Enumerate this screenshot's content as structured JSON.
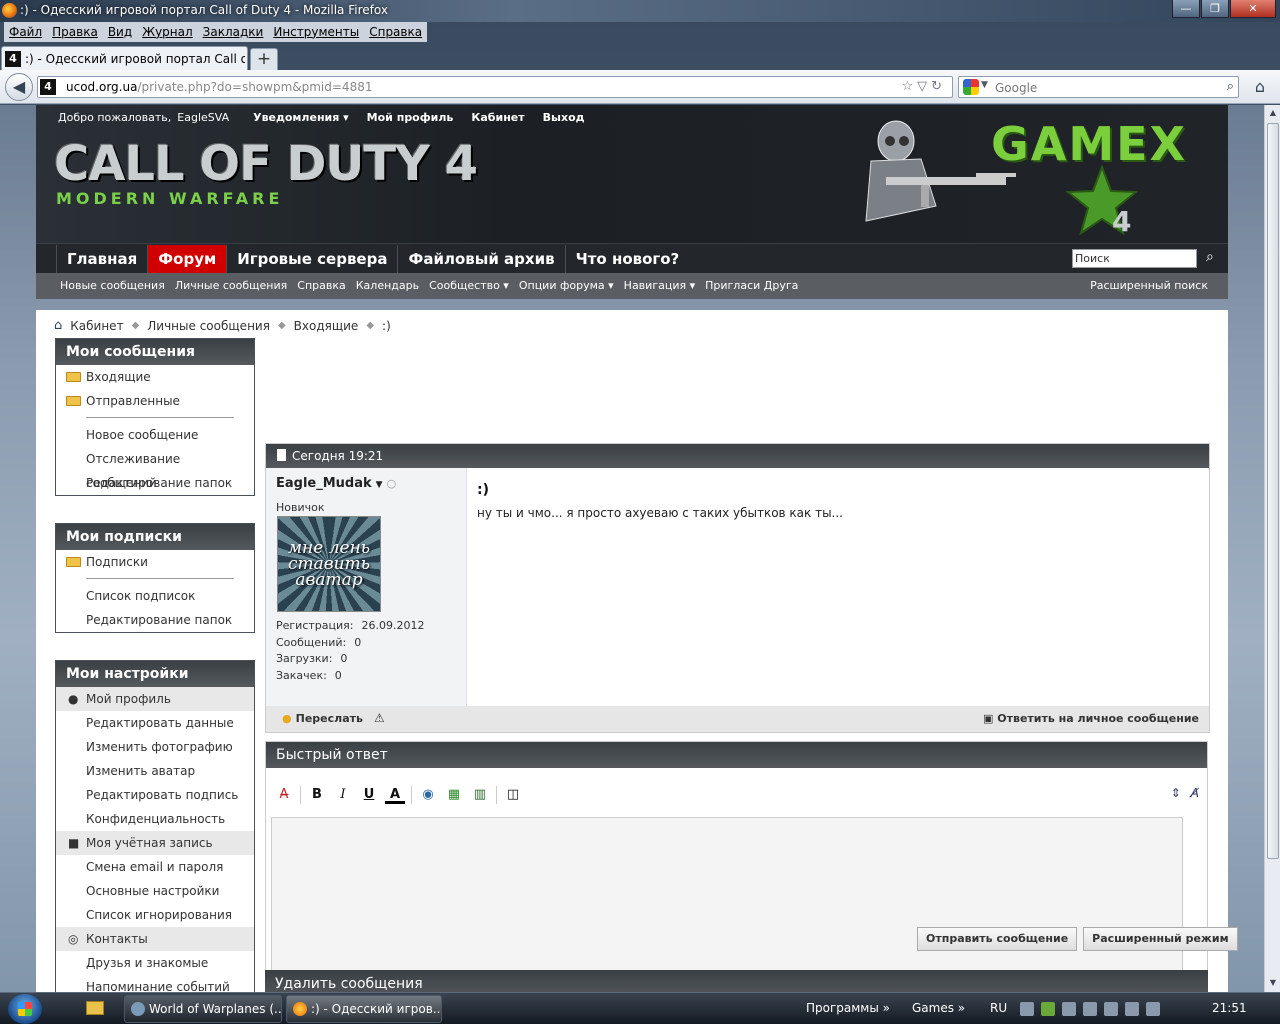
{
  "window": {
    "title": ":) - Одесский игровой портал Call of Duty 4 - Mozilla Firefox",
    "menu": [
      "Файл",
      "Правка",
      "Вид",
      "Журнал",
      "Закладки",
      "Инструменты",
      "Справка"
    ],
    "tab_label": ":) - Одесский игровой портал Call of D...",
    "favicon_text": "4",
    "new_tab": "+",
    "url_host": "ucod.org.ua",
    "url_path": "/private.php?do=showpm&pmid=4881",
    "search_engine": "Google"
  },
  "header": {
    "welcome": "Добро пожаловать,",
    "username": "EagleSVA",
    "links": [
      "Уведомления ▾",
      "Мой профиль",
      "Кабинет",
      "Выход"
    ],
    "logo_cod": "CALL OF DUTY 4",
    "logo_mw": "MODERN WARFARE",
    "logo_gamex": "GAMEX",
    "logo_4": "4"
  },
  "nav": {
    "items": [
      "Главная",
      "Форум",
      "Игровые сервера",
      "Файловый архив",
      "Что нового?"
    ],
    "active_index": 1,
    "search_value": "Поиск",
    "sub_items": [
      "Новые сообщения",
      "Личные сообщения",
      "Справка",
      "Календарь",
      "Сообщество ▾",
      "Опции форума ▾",
      "Навигация ▾",
      "Пригласи Друга"
    ],
    "advanced_search": "Расширенный поиск"
  },
  "breadcrumb": [
    "Кабинет",
    "Личные сообщения",
    "Входящие",
    ":)"
  ],
  "sidebar": {
    "messages": {
      "title": "Мои сообщения",
      "folders": [
        "Входящие",
        "Отправленные"
      ],
      "links": [
        "Новое сообщение",
        "Отслеживание сообщений",
        "Редактирование папок"
      ]
    },
    "subscriptions": {
      "title": "Мои подписки",
      "folders": [
        "Подписки"
      ],
      "links": [
        "Список подписок",
        "Редактирование папок"
      ]
    },
    "settings": {
      "title": "Мои настройки",
      "profile_section": "Мой профиль",
      "profile_links": [
        "Редактировать данные",
        "Изменить фотографию",
        "Изменить аватар",
        "Редактировать подпись",
        "Конфиденциальность"
      ],
      "account_section": "Моя учётная запись",
      "account_links": [
        "Смена email и пароля",
        "Основные настройки",
        "Список игнорирования"
      ],
      "contacts_section": "Контакты",
      "contacts_links": [
        "Друзья и знакомые",
        "Напоминание событий"
      ]
    }
  },
  "message": {
    "date": "Сегодня 19:21",
    "author": "Eagle_Mudak",
    "rank": "Новичок",
    "avatar_text": "мне лень ставить аватар",
    "stats": [
      {
        "label": "Регистрация:",
        "value": "26.09.2012"
      },
      {
        "label": "Сообщений:",
        "value": "0"
      },
      {
        "label": "Загрузки:",
        "value": "0"
      },
      {
        "label": "Закачек:",
        "value": "0"
      }
    ],
    "subject": ":)",
    "body": "ну ты и чмо... я просто ахуеваю с таких убытков как ты...",
    "forward": "Переслать",
    "reply": "Ответить на личное сообщение"
  },
  "quick_reply": {
    "title": "Быстрый ответ",
    "send": "Отправить сообщение",
    "advanced": "Расширенный режим"
  },
  "delete_title": "Удалить сообщения",
  "taskbar": {
    "tasks": [
      "World of Warplanes (...",
      ":) - Одесский игров..."
    ],
    "toolbars": [
      "Программы »",
      "Games »"
    ],
    "lang": "RU",
    "clock": "21:51"
  }
}
